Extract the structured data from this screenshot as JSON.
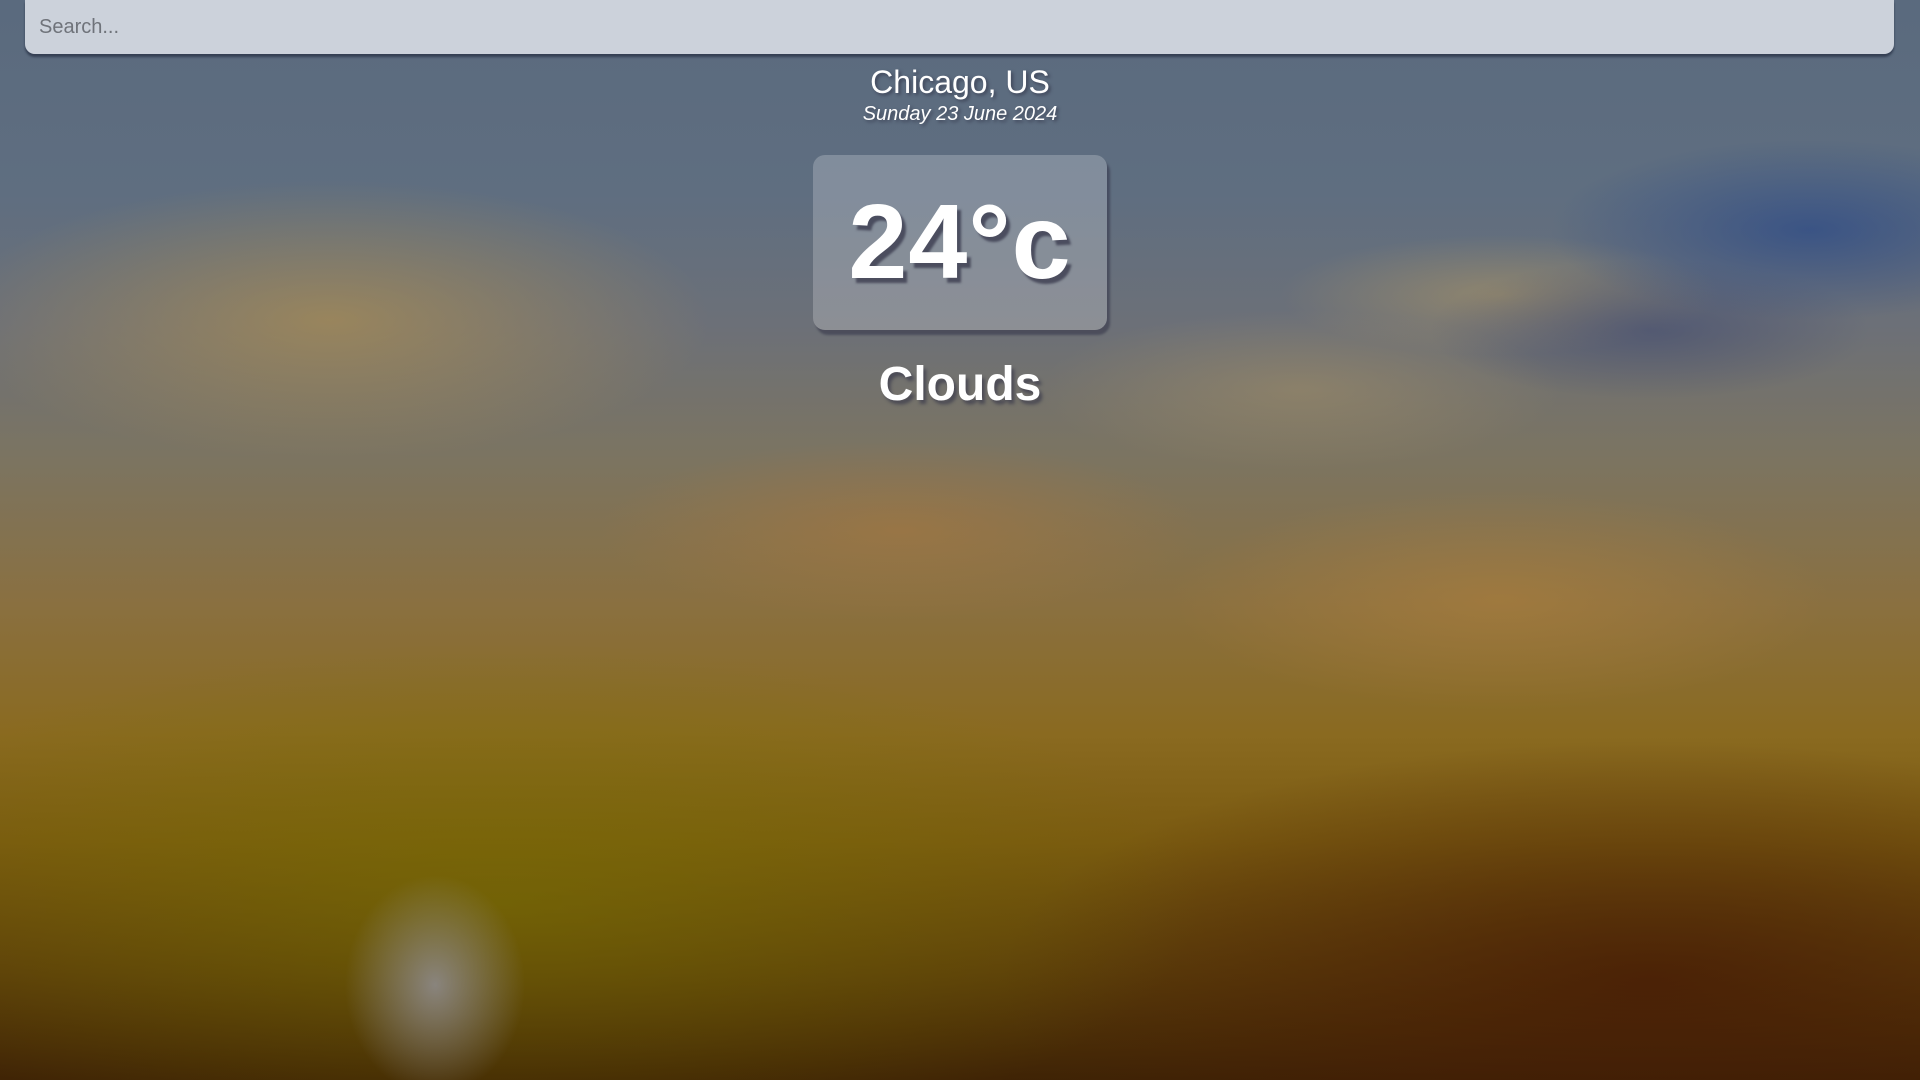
{
  "search": {
    "placeholder": "Search...",
    "value": ""
  },
  "location": {
    "city": "Chicago, US",
    "date": "Sunday 23 June 2024"
  },
  "weather": {
    "temperature": "24°c",
    "condition": "Clouds"
  },
  "colors": {
    "text": "#ffffff",
    "search_bar": "#dce0e8",
    "sky_top": "#5a6a7e",
    "sky_bottom": "#3f2305"
  },
  "background": {
    "description_icon": "sunset-sky-background"
  }
}
